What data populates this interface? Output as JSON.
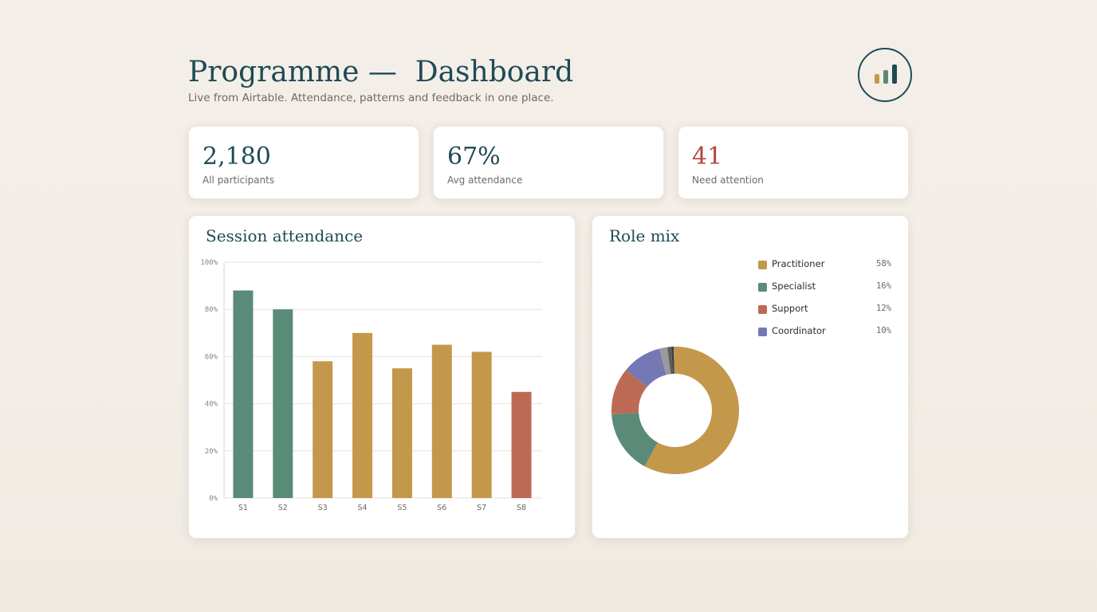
{
  "header": {
    "title": "Programme —  Dashboard",
    "subtitle": "Live from Airtable. Attendance, patterns and feedback in one place.",
    "logo_icon": "bar-chart-icon",
    "logo_colors": [
      "#c4984a",
      "#5a8a78",
      "#1d4b55"
    ]
  },
  "kpis": [
    {
      "value": "2,180",
      "label": "All participants",
      "color": "#1d4b55"
    },
    {
      "value": "67%",
      "label": "Avg attendance",
      "color": "#1d4b55"
    },
    {
      "value": "41",
      "label": "Need attention",
      "color": "#b0483a"
    }
  ],
  "colors": {
    "green": "#5a8a78",
    "gold": "#c4984a",
    "red": "#bd6a54",
    "purple": "#7479b5",
    "grid": "#e6e2dc"
  },
  "chart_data": [
    {
      "type": "bar",
      "title": "Session attendance",
      "categories": [
        "S1",
        "S2",
        "S3",
        "S4",
        "S5",
        "S6",
        "S7",
        "S8"
      ],
      "values": [
        88,
        80,
        58,
        70,
        55,
        65,
        62,
        45
      ],
      "bar_colors": [
        "#5a8a78",
        "#5a8a78",
        "#c4984a",
        "#c4984a",
        "#c4984a",
        "#c4984a",
        "#c4984a",
        "#bd6a54"
      ],
      "ylim": [
        0,
        100
      ],
      "yticks": [
        "0%",
        "20%",
        "40%",
        "60%",
        "80%",
        "100%"
      ],
      "grid": true
    },
    {
      "type": "pie",
      "title": "Role mix",
      "donut": true,
      "legend": "top-right",
      "slices": [
        {
          "label": "Practitioner",
          "pct": "58%",
          "value": 58,
          "color": "#c4984a"
        },
        {
          "label": "Specialist",
          "pct": "16%",
          "value": 16,
          "color": "#5a8a78"
        },
        {
          "label": "Support",
          "pct": "12%",
          "value": 12,
          "color": "#bd6a54"
        },
        {
          "label": "Coordinator",
          "pct": "10%",
          "value": 10,
          "color": "#7479b5"
        },
        {
          "value": 2,
          "color": "#9a9a9a"
        },
        {
          "value": 1,
          "color": "#5e5e5e"
        },
        {
          "value": 0.6,
          "color": "#3d3d4a"
        },
        {
          "value": 0.4,
          "color": "#c4984a"
        }
      ]
    }
  ]
}
